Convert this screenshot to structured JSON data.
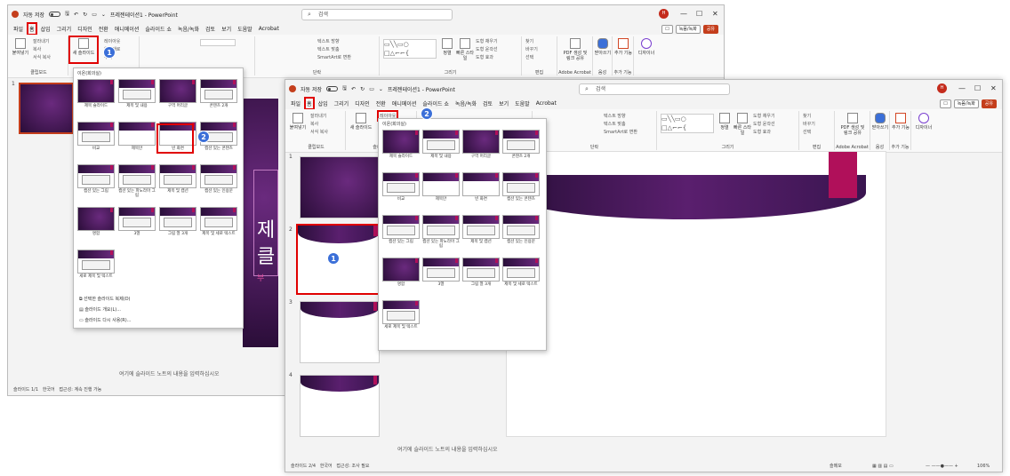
{
  "app": {
    "autosave": "자동 저장",
    "title": "프레젠테이션1 - PowerPoint",
    "search_placeholder": "검색",
    "avatar": "H"
  },
  "window_controls": {
    "minimize": "—",
    "restore": "☐",
    "close": "✕"
  },
  "menu": [
    "파일",
    "홈",
    "삽입",
    "그리기",
    "디자인",
    "전환",
    "애니메이션",
    "슬라이드 쇼",
    "녹음/녹화",
    "검토",
    "보기",
    "도움말",
    "Acrobat"
  ],
  "menu_right": {
    "comment": "☐",
    "record": "녹음/녹화",
    "share": "공유"
  },
  "ribbon": {
    "paste": "붙여넣기",
    "cut": "잘라내기",
    "copy": "복사",
    "format_painter": "서식 복사",
    "clipboard": "클립보드",
    "new_slide": "새 슬라이드",
    "layout": "레이아웃",
    "reset": "원래대로",
    "section": "구역",
    "slides": "슬라이드",
    "font": "글꼴",
    "paragraph": "단락",
    "text_direction": "텍스트 방향",
    "align_text": "텍스트 맞춤",
    "smartart": "SmartArt로 변환",
    "arrange": "정렬",
    "quick_styles": "빠른 스타일",
    "shape_fill": "도형 채우기",
    "shape_outline": "도형 윤곽선",
    "shape_effects": "도형 효과",
    "drawing": "그리기",
    "find": "찾기",
    "replace": "바꾸기",
    "select": "선택",
    "editing": "편집",
    "pdf": "PDF 생성 및 링크 공유",
    "acrobat": "Adobe Acrobat",
    "dictate": "받아쓰기",
    "voice": "음성",
    "addins": "추가 기능",
    "addins_group": "추가 기능",
    "designer": "디자이너"
  },
  "layout_popup": {
    "header": "이온(회의실)",
    "items": [
      "제목 슬라이드",
      "제목 및 내용",
      "구역 머리글",
      "콘텐츠 2개",
      "비교",
      "제목만",
      "빈 화면",
      "캡션 있는 콘텐츠",
      "캡션 있는 그림",
      "캡션 있는 파노라마 그림",
      "제목 및 캡션",
      "캡션 있는 인용문",
      "명함",
      "3열",
      "그림 열 3개",
      "제목 및 세로 텍스트",
      "세로 제목 및 텍스트"
    ],
    "menu": [
      "선택한 슬라이드 복제(D)",
      "슬라이드 개요(L)...",
      "슬라이드 다시 사용(R)..."
    ]
  },
  "badges": {
    "one": "1",
    "two": "2"
  },
  "w1": {
    "slide_num": "1",
    "notes": "여기에 슬라이드 노트의 내용을 입력하십시오",
    "status": "슬라이드 1/1",
    "lang": "한국어",
    "access": "접근성: 계속 진행 가능",
    "slide_title_char": "제",
    "slide_sub_char": "클",
    "slide_small_char": "부"
  },
  "w2": {
    "thumbs": [
      "1",
      "2",
      "3",
      "4"
    ],
    "notes": "여기에 슬라이드 노트의 내용을 입력하십시오",
    "status": "슬라이드 2/4",
    "lang": "한국어",
    "access": "접근성: 조사 필요",
    "notes_btn": "슬메모",
    "zoom": "106%"
  }
}
